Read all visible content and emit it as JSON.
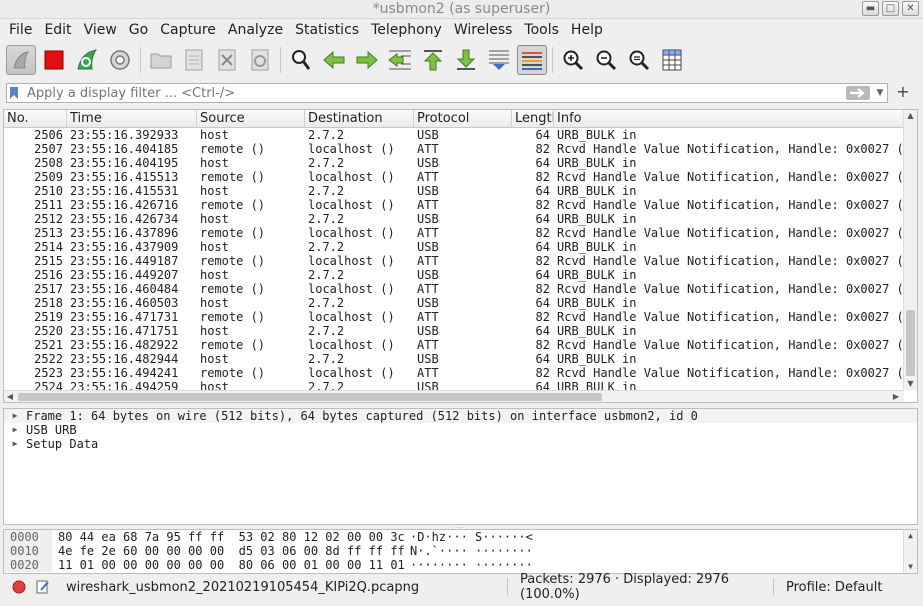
{
  "window": {
    "title": "*usbmon2 (as superuser)"
  },
  "menu": [
    "File",
    "Edit",
    "View",
    "Go",
    "Capture",
    "Analyze",
    "Statistics",
    "Telephony",
    "Wireless",
    "Tools",
    "Help"
  ],
  "toolbar": {
    "buttons": [
      "start-capture-icon",
      "stop-capture-icon",
      "restart-capture-icon",
      "capture-options-icon",
      "open-file-icon",
      "save-file-icon",
      "close-file-icon",
      "reload-file-icon",
      "find-packet-icon",
      "go-back-icon",
      "go-forward-icon",
      "go-to-packet-icon",
      "first-packet-icon",
      "last-packet-icon",
      "autoscroll-icon",
      "colorize-icon",
      "zoom-in-icon",
      "zoom-out-icon",
      "zoom-normal-icon",
      "resize-columns-icon"
    ]
  },
  "filter": {
    "placeholder": "Apply a display filter ... <Ctrl-/>",
    "value": ""
  },
  "packet_list": {
    "columns": [
      "No.",
      "Time",
      "Source",
      "Destination",
      "Protocol",
      "Length",
      "Info"
    ],
    "rows": [
      [
        "2506",
        "23:55:16.392933",
        "host",
        "2.7.2",
        "USB",
        "64",
        "URB_BULK in"
      ],
      [
        "2507",
        "23:55:16.404185",
        "remote ()",
        "localhost ()",
        "ATT",
        "82",
        "Rcvd Handle Value Notification, Handle: 0x0027 ("
      ],
      [
        "2508",
        "23:55:16.404195",
        "host",
        "2.7.2",
        "USB",
        "64",
        "URB_BULK in"
      ],
      [
        "2509",
        "23:55:16.415513",
        "remote ()",
        "localhost ()",
        "ATT",
        "82",
        "Rcvd Handle Value Notification, Handle: 0x0027 ("
      ],
      [
        "2510",
        "23:55:16.415531",
        "host",
        "2.7.2",
        "USB",
        "64",
        "URB_BULK in"
      ],
      [
        "2511",
        "23:55:16.426716",
        "remote ()",
        "localhost ()",
        "ATT",
        "82",
        "Rcvd Handle Value Notification, Handle: 0x0027 ("
      ],
      [
        "2512",
        "23:55:16.426734",
        "host",
        "2.7.2",
        "USB",
        "64",
        "URB_BULK in"
      ],
      [
        "2513",
        "23:55:16.437896",
        "remote ()",
        "localhost ()",
        "ATT",
        "82",
        "Rcvd Handle Value Notification, Handle: 0x0027 ("
      ],
      [
        "2514",
        "23:55:16.437909",
        "host",
        "2.7.2",
        "USB",
        "64",
        "URB_BULK in"
      ],
      [
        "2515",
        "23:55:16.449187",
        "remote ()",
        "localhost ()",
        "ATT",
        "82",
        "Rcvd Handle Value Notification, Handle: 0x0027 ("
      ],
      [
        "2516",
        "23:55:16.449207",
        "host",
        "2.7.2",
        "USB",
        "64",
        "URB_BULK in"
      ],
      [
        "2517",
        "23:55:16.460484",
        "remote ()",
        "localhost ()",
        "ATT",
        "82",
        "Rcvd Handle Value Notification, Handle: 0x0027 ("
      ],
      [
        "2518",
        "23:55:16.460503",
        "host",
        "2.7.2",
        "USB",
        "64",
        "URB_BULK in"
      ],
      [
        "2519",
        "23:55:16.471731",
        "remote ()",
        "localhost ()",
        "ATT",
        "82",
        "Rcvd Handle Value Notification, Handle: 0x0027 ("
      ],
      [
        "2520",
        "23:55:16.471751",
        "host",
        "2.7.2",
        "USB",
        "64",
        "URB_BULK in"
      ],
      [
        "2521",
        "23:55:16.482922",
        "remote ()",
        "localhost ()",
        "ATT",
        "82",
        "Rcvd Handle Value Notification, Handle: 0x0027 ("
      ],
      [
        "2522",
        "23:55:16.482944",
        "host",
        "2.7.2",
        "USB",
        "64",
        "URB_BULK in"
      ],
      [
        "2523",
        "23:55:16.494241",
        "remote ()",
        "localhost ()",
        "ATT",
        "82",
        "Rcvd Handle Value Notification, Handle: 0x0027 ("
      ],
      [
        "2524",
        "23:55:16.494259",
        "host",
        "2.7.2",
        "USB",
        "64",
        "URB_BULK in"
      ]
    ]
  },
  "details": [
    "Frame 1: 64 bytes on wire (512 bits), 64 bytes captured (512 bits) on interface usbmon2, id 0",
    "USB URB",
    "Setup Data"
  ],
  "bytes": [
    {
      "offset": "0000",
      "hex": "80 44 ea 68 7a 95 ff ff  53 02 80 12 02 00 00 3c",
      "ascii": "·D·hz··· S······<"
    },
    {
      "offset": "0010",
      "hex": "4e fe 2e 60 00 00 00 00  d5 03 06 00 8d ff ff ff",
      "ascii": "N·.`···· ········"
    },
    {
      "offset": "0020",
      "hex": "11 01 00 00 00 00 00 00  80 06 00 01 00 00 11 01",
      "ascii": "········ ········"
    }
  ],
  "status": {
    "file": "wireshark_usbmon2_20210219105454_KIPi2Q.pcapng",
    "packets": "Packets: 2976 · Displayed: 2976 (100.0%)",
    "profile": "Profile: Default"
  },
  "colors": {
    "stop": "#e01010",
    "arrow_green": "#43a047",
    "filter_border": "#9fb6cd"
  }
}
